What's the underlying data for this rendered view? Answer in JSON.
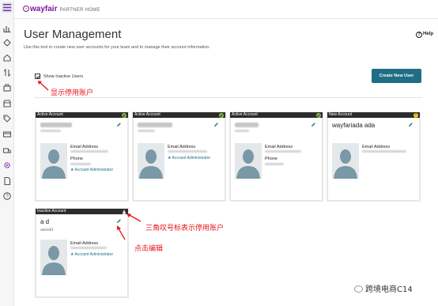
{
  "header": {
    "brand": "wayfair",
    "brand_sub": "PARTNER HOME"
  },
  "page": {
    "title": "User Management",
    "help_label": "Help",
    "description": "Use this tool to create new user accounts for your team and to manage their account information.",
    "show_inactive_label": "Show Inactive Users",
    "show_inactive_checked": true,
    "create_button": "Create New User"
  },
  "sidebar": {
    "icons": [
      "menu-icon",
      "chart-icon",
      "tag-icon",
      "home-icon",
      "sort-icon",
      "box-icon",
      "store-icon",
      "price-tag-icon",
      "card-icon",
      "truck-icon",
      "gear-icon",
      "document-icon",
      "question-icon"
    ]
  },
  "annotations": {
    "show_inactive": "显示停用账户",
    "triangle_note": "三角叹号标表示停用账户",
    "click_edit": "点击编辑"
  },
  "cards": [
    {
      "status": "Active Account",
      "badge": "check",
      "name": "",
      "email_label": "Email Address",
      "phone_label": "Phone",
      "role": "Account Administrator"
    },
    {
      "status": "Active Account",
      "badge": "check",
      "name": "",
      "email_label": "Email Address",
      "phone_label": "",
      "role": "Account Administrator"
    },
    {
      "status": "Active Account",
      "badge": "check",
      "name": "",
      "email_label": "Email Address",
      "phone_label": "Phone",
      "role": ""
    },
    {
      "status": "New Account",
      "badge": "!",
      "name": "wayfariada ada",
      "email_label": "Email Address",
      "phone_label": "",
      "role": ""
    },
    {
      "status": "Inactive Account",
      "badge": "!",
      "name": "a d",
      "sub": "aassdd",
      "email_label": "Email Address",
      "phone_label": "",
      "role": "Account Administrator"
    }
  ],
  "watermark": "跨境电商C14",
  "colors": {
    "brand": "#7b189f",
    "accent": "#1f6e84",
    "annotation": "#e8141c",
    "active_badge": "#8fc23a",
    "new_badge": "#f5c518"
  }
}
